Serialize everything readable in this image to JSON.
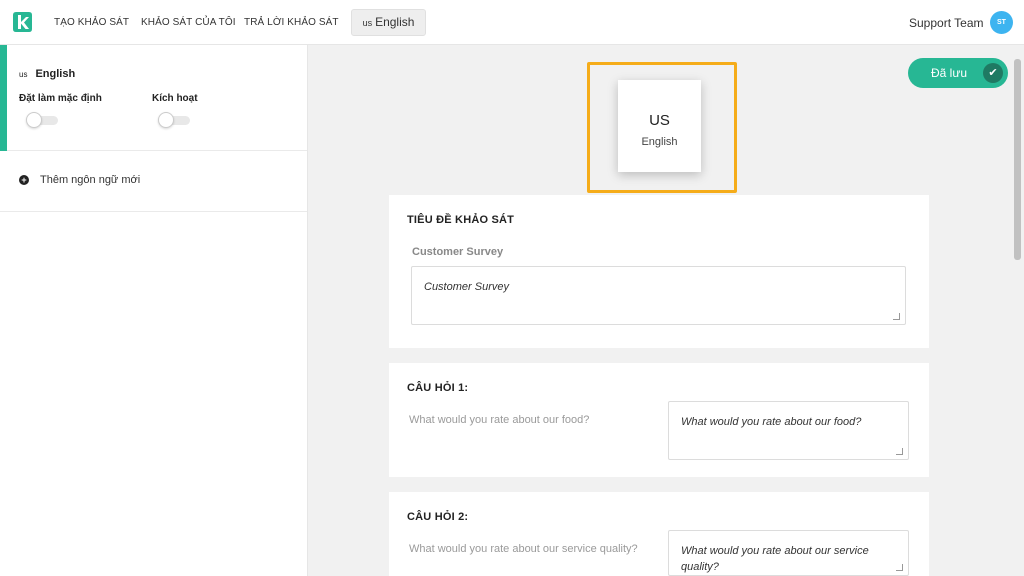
{
  "nav": {
    "links": [
      "TẠO KHẢO SÁT",
      "KHẢO SÁT CỦA TÔI",
      "TRẢ LỜI KHẢO SÁT"
    ],
    "current_language": {
      "code": "us",
      "name": "English"
    },
    "user_name": "Support Team",
    "user_initials": "ST"
  },
  "sidebar": {
    "language": {
      "code": "us",
      "name": "English"
    },
    "set_default_label": "Đặt làm mặc định",
    "activate_label": "Kích hoạt",
    "set_default_on": false,
    "activate_on": false,
    "add_language_label": "Thêm ngôn ngữ mới"
  },
  "main": {
    "saved_label": "Đã lưu",
    "language_card": {
      "code": "US",
      "name": "English"
    },
    "title_section": {
      "heading": "TIÊU ĐỀ KHẢO SÁT",
      "original": "Customer Survey",
      "translation": "Customer Survey"
    },
    "questions": [
      {
        "heading": "CÂU HỎI 1:",
        "original": "What would you rate about our food?",
        "translation": "What would you rate about our food?"
      },
      {
        "heading": "CÂU HỎI 2:",
        "original": "What would you rate about our service quality?",
        "translation": "What would you rate about our service quality?"
      }
    ]
  },
  "colors": {
    "accent": "#27b794",
    "highlight": "#f5ac1a",
    "avatar": "#3db4f0"
  }
}
